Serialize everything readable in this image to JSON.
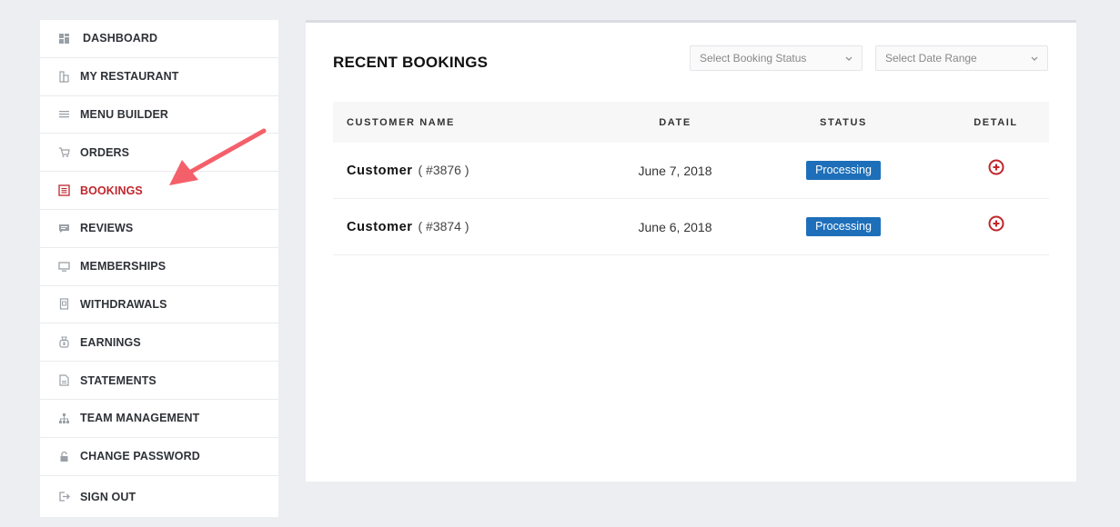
{
  "sidebar": {
    "items": [
      {
        "label": "DASHBOARD",
        "icon": "dashboard-icon"
      },
      {
        "label": "MY RESTAURANT",
        "icon": "restaurant-icon"
      },
      {
        "label": "MENU BUILDER",
        "icon": "menu-icon"
      },
      {
        "label": "ORDERS",
        "icon": "cart-icon"
      },
      {
        "label": "BOOKINGS",
        "icon": "bookings-icon",
        "active": true
      },
      {
        "label": "REVIEWS",
        "icon": "comment-icon"
      },
      {
        "label": "MEMBERSHIPS",
        "icon": "monitor-icon"
      },
      {
        "label": "WITHDRAWALS",
        "icon": "withdrawal-icon"
      },
      {
        "label": "EARNINGS",
        "icon": "money-bag-icon"
      },
      {
        "label": "STATEMENTS",
        "icon": "document-icon"
      },
      {
        "label": "TEAM MANAGEMENT",
        "icon": "sitemap-icon"
      },
      {
        "label": "CHANGE PASSWORD",
        "icon": "lock-icon"
      },
      {
        "label": "SIGN OUT",
        "icon": "sign-out-icon"
      }
    ]
  },
  "main": {
    "title": "RECENT BOOKINGS",
    "filters": {
      "status_placeholder": "Select Booking Status",
      "date_placeholder": "Select Date Range"
    },
    "table": {
      "headers": [
        "CUSTOMER NAME",
        "DATE",
        "STATUS",
        "DETAIL"
      ],
      "rows": [
        {
          "customer": "Customer",
          "id": "( #3876 )",
          "date": "June 7, 2018",
          "status": "Processing"
        },
        {
          "customer": "Customer",
          "id": "( #3874 )",
          "date": "June 6, 2018",
          "status": "Processing"
        }
      ]
    }
  },
  "colors": {
    "active": "#c0262c",
    "badge": "#1e6fb9",
    "background": "#eceef2",
    "arrow": "#f4606a"
  }
}
